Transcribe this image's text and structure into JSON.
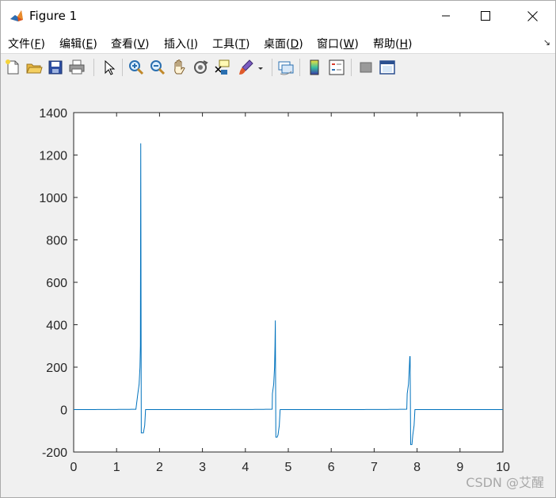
{
  "window": {
    "title": "Figure 1",
    "icon": "matlab-icon",
    "controls": [
      "minimize-icon",
      "maximize-icon",
      "close-icon"
    ]
  },
  "menu": {
    "items": [
      {
        "label": "文件(",
        "key": "F",
        "tail": ")"
      },
      {
        "label": "编辑(",
        "key": "E",
        "tail": ")"
      },
      {
        "label": "查看(",
        "key": "V",
        "tail": ")"
      },
      {
        "label": "插入(",
        "key": "I",
        "tail": ")"
      },
      {
        "label": "工具(",
        "key": "T",
        "tail": ")"
      },
      {
        "label": "桌面(",
        "key": "D",
        "tail": ")"
      },
      {
        "label": "窗口(",
        "key": "W",
        "tail": ")"
      },
      {
        "label": "帮助(",
        "key": "H",
        "tail": ")"
      }
    ],
    "overflow_icon": "dock-arrow-icon"
  },
  "toolbar": {
    "buttons": [
      "new-figure-icon",
      "open-icon",
      "save-icon",
      "print-icon",
      "select-pointer-icon",
      "zoom-in-icon",
      "zoom-out-icon",
      "pan-hand-icon",
      "rotate-3d-icon",
      "data-cursor-icon",
      "brush-icon",
      "link-plot-icon",
      "colorbar-icon",
      "legend-icon",
      "hide-plot-tools-icon",
      "show-plot-tools-icon"
    ]
  },
  "chart_data": {
    "type": "line",
    "title": "",
    "xlabel": "",
    "ylabel": "",
    "xlim": [
      0,
      10
    ],
    "ylim": [
      -200,
      1400
    ],
    "xticks": [
      0,
      1,
      2,
      3,
      4,
      5,
      6,
      7,
      8,
      9,
      10
    ],
    "yticks": [
      -200,
      0,
      200,
      400,
      600,
      800,
      1000,
      1200,
      1400
    ],
    "grid": false,
    "series": [
      {
        "color": "#0072bd",
        "spikes": [
          {
            "x": 1.575,
            "peak": 1255,
            "trough": -110
          },
          {
            "x": 4.71,
            "peak": 420,
            "trough": -130
          },
          {
            "x": 7.85,
            "peak": 250,
            "trough": -165
          }
        ],
        "baseline": 0
      }
    ]
  },
  "watermark": "CSDN @艾醒"
}
